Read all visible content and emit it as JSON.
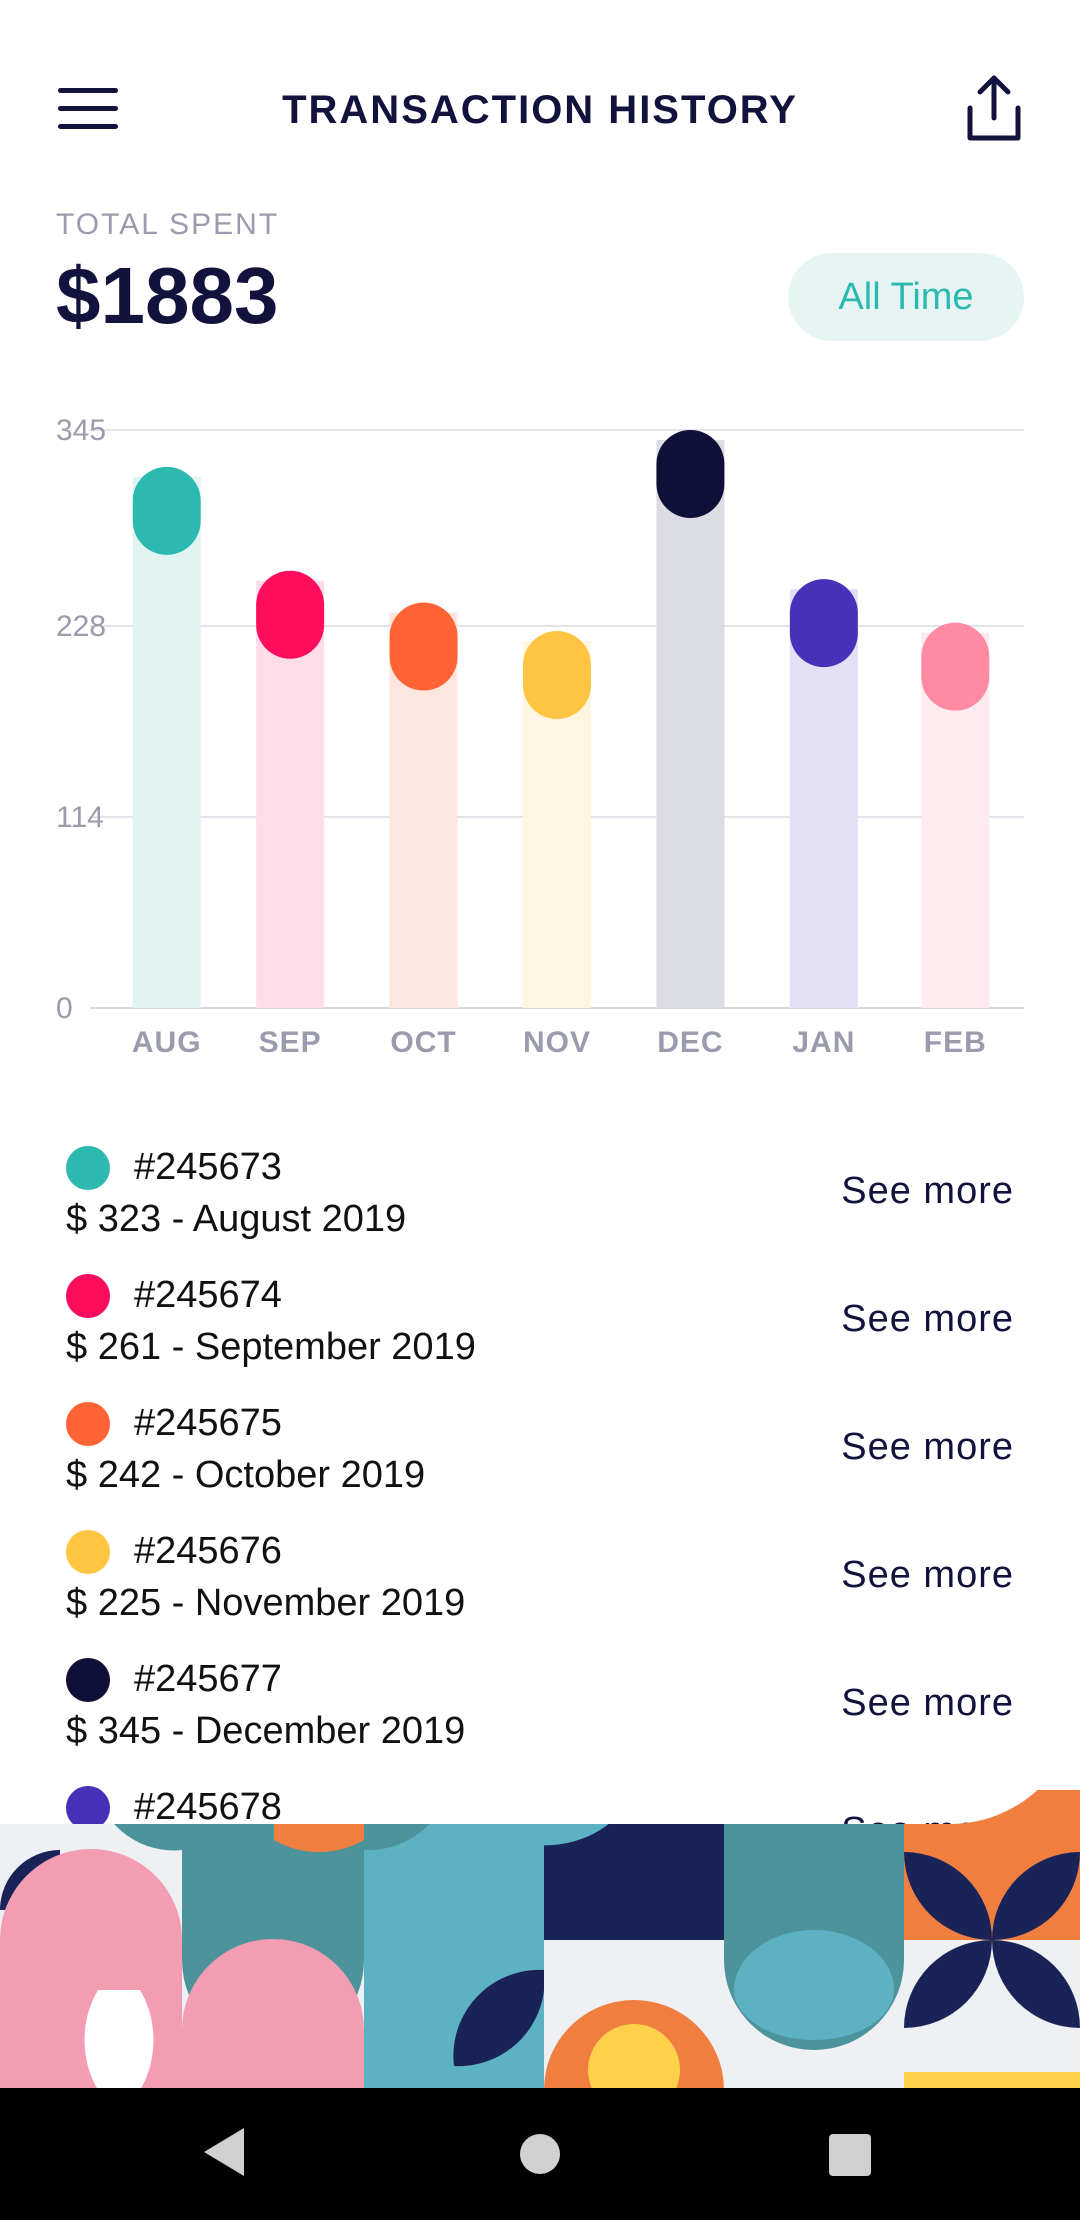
{
  "header": {
    "title": "TRANSACTION HISTORY",
    "menu_icon": "menu-icon",
    "share_icon": "share-icon"
  },
  "summary": {
    "label": "TOTAL SPENT",
    "value": "$1883",
    "period": "All Time"
  },
  "chart_data": {
    "type": "bar",
    "categories": [
      "AUG",
      "SEP",
      "OCT",
      "NOV",
      "DEC",
      "JAN",
      "FEB"
    ],
    "values": [
      323,
      261,
      242,
      225,
      345,
      256,
      230
    ],
    "yticks": [
      345,
      228,
      114,
      0
    ],
    "ylim": [
      0,
      345
    ],
    "grid": true,
    "colors": [
      "#2bb9b0",
      "#ff0d5c",
      "#ff6336",
      "#ffc542",
      "#0e1038",
      "#4631b8",
      "#ff8aa2"
    ],
    "track_colors": [
      "#e1f4f2",
      "#ffdde8",
      "#fde6de",
      "#fff6e2",
      "#dcdce3",
      "#e3e0f5",
      "#ffeaf0"
    ]
  },
  "transactions": [
    {
      "id": "#245673",
      "detail": "$ 323 - August 2019",
      "more": "See more",
      "color": "#2bb9b0"
    },
    {
      "id": "#245674",
      "detail": "$ 261 - September 2019",
      "more": "See more",
      "color": "#ff0d5c"
    },
    {
      "id": "#245675",
      "detail": "$ 242 - October 2019",
      "more": "See more",
      "color": "#ff6336"
    },
    {
      "id": "#245676",
      "detail": "$ 225 - November 2019",
      "more": "See more",
      "color": "#ffc542"
    },
    {
      "id": "#245677",
      "detail": "$ 345 - December 2019",
      "more": "See more",
      "color": "#0e1038"
    },
    {
      "id": "#245678",
      "detail": "",
      "more": "See more",
      "color": "#4631b8"
    }
  ],
  "navbar": {
    "back_icon": "back-icon",
    "home_icon": "home-icon",
    "recents_icon": "recents-icon"
  }
}
